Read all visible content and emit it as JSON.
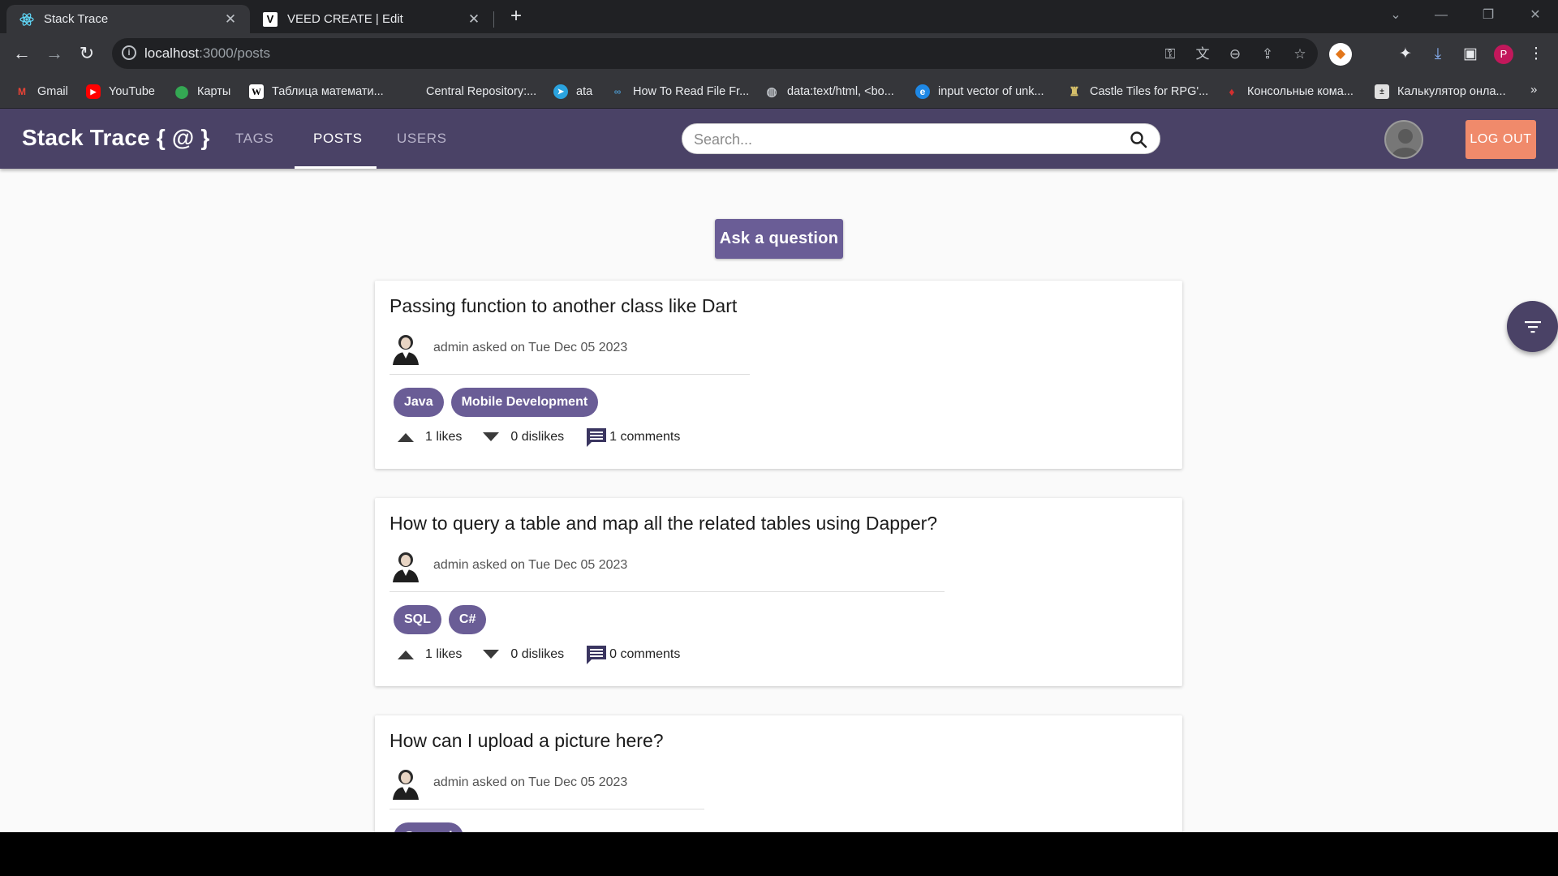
{
  "browser": {
    "tabs": [
      {
        "title": "Stack Trace",
        "icon": "react-icon"
      },
      {
        "title": "VEED CREATE | Edit",
        "icon": "veed-icon"
      }
    ],
    "url_host": "localhost",
    "url_path": ":3000/posts",
    "bookmarks": [
      {
        "label": "Gmail",
        "icon": "gmail-icon",
        "color": "#ea4335"
      },
      {
        "label": "YouTube",
        "icon": "youtube-icon",
        "color": "#ff0000"
      },
      {
        "label": "Карты",
        "icon": "maps-icon",
        "color": "#34a853"
      },
      {
        "label": "Таблица математи...",
        "icon": "wiki-icon",
        "color": "#ffffff"
      },
      {
        "label": "Central Repository:...",
        "icon": "",
        "color": ""
      },
      {
        "label": "ata",
        "icon": "telegram-icon",
        "color": "#2aa3df"
      },
      {
        "label": "How To Read File Fr...",
        "icon": "link-icon",
        "color": "#4a90c0"
      },
      {
        "label": "data:text/html, <bo...",
        "icon": "globe-icon",
        "color": "#9aa0a6"
      },
      {
        "label": "input vector of unk...",
        "icon": "edge-icon",
        "color": "#1e88e5"
      },
      {
        "label": "Castle Tiles for RPG'...",
        "icon": "castle-icon",
        "color": "#d6c06a"
      },
      {
        "label": "Консольные кома...",
        "icon": "flame-icon",
        "color": "#d32f2f"
      },
      {
        "label": "Калькулятор онла...",
        "icon": "calculator-icon",
        "color": "#e0e0e0"
      }
    ],
    "profile_initial": "P"
  },
  "app": {
    "brand": "Stack Trace { @ }",
    "nav": [
      "TAGS",
      "POSTS",
      "USERS"
    ],
    "active_nav": "POSTS",
    "search_placeholder": "Search...",
    "logout_label": "LOG OUT",
    "ask_label": "Ask a question",
    "accent": "#6a5d96",
    "appbar_color": "#4a4266",
    "logout_color": "#f08a6b"
  },
  "posts": [
    {
      "title": "Passing function to another class like Dart",
      "author": "admin",
      "asked_word": "asked",
      "on_word": "on",
      "date": "Tue Dec 05 2023",
      "tags": [
        "Java",
        "Mobile Development"
      ],
      "likes": "1 likes",
      "dislikes": "0 dislikes",
      "comments": "1 comments"
    },
    {
      "title": "How to query a table and map all the related tables using Dapper?",
      "author": "admin",
      "asked_word": "asked",
      "on_word": "on",
      "date": "Tue Dec 05 2023",
      "tags": [
        "SQL",
        "C#"
      ],
      "likes": "1 likes",
      "dislikes": "0 dislikes",
      "comments": "0 comments"
    },
    {
      "title": "How can I upload a picture here?",
      "author": "admin",
      "asked_word": "asked",
      "on_word": "on",
      "date": "Tue Dec 05 2023",
      "tags": [
        "General"
      ],
      "likes": "",
      "dislikes": "",
      "comments": ""
    }
  ]
}
